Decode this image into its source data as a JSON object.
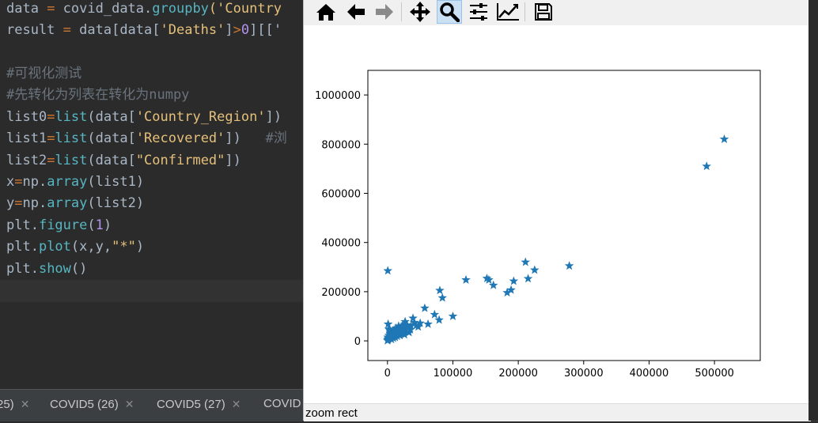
{
  "editor": {
    "lines": [
      {
        "parts": [
          [
            "data",
            "kw-var"
          ],
          [
            " = ",
            "kw-op"
          ],
          [
            "covid_data.",
            "kw-var"
          ],
          [
            "groupby",
            "kw-fn"
          ],
          [
            "('Country",
            "kw-str"
          ]
        ]
      },
      {
        "parts": [
          [
            "result",
            "kw-var"
          ],
          [
            " = ",
            "kw-op"
          ],
          [
            "data[data[",
            "kw-var"
          ],
          [
            "'Deaths'",
            "kw-str"
          ],
          [
            "]",
            "kw-var"
          ],
          [
            ">",
            "kw-op"
          ],
          [
            "0",
            "kw-num"
          ],
          [
            "][['",
            "kw-var"
          ]
        ]
      },
      {
        "parts": [
          [
            "",
            "kw-var"
          ]
        ]
      },
      {
        "parts": [
          [
            "#可视化测试",
            "kw-cmt"
          ]
        ]
      },
      {
        "parts": [
          [
            "#先转化为列表在转化为numpy",
            "kw-cmt"
          ]
        ]
      },
      {
        "parts": [
          [
            "list0",
            "kw-var"
          ],
          [
            "=",
            "kw-op"
          ],
          [
            "list",
            "kw-fn"
          ],
          [
            "(data[",
            "kw-var"
          ],
          [
            "'Country_Region'",
            "kw-str"
          ],
          [
            "])",
            "kw-var"
          ]
        ]
      },
      {
        "parts": [
          [
            "list1",
            "kw-var"
          ],
          [
            "=",
            "kw-op"
          ],
          [
            "list",
            "kw-fn"
          ],
          [
            "(data[",
            "kw-var"
          ],
          [
            "'Recovered'",
            "kw-str"
          ],
          [
            "])   ",
            "kw-var"
          ],
          [
            "#浏",
            "kw-cmt"
          ]
        ]
      },
      {
        "parts": [
          [
            "list2",
            "kw-var"
          ],
          [
            "=",
            "kw-op"
          ],
          [
            "list",
            "kw-fn"
          ],
          [
            "(data[",
            "kw-var"
          ],
          [
            "\"Confirmed\"",
            "kw-str"
          ],
          [
            "])",
            "kw-var"
          ]
        ]
      },
      {
        "parts": [
          [
            "x",
            "kw-var"
          ],
          [
            "=",
            "kw-op"
          ],
          [
            "np.",
            "kw-var"
          ],
          [
            "array",
            "kw-fn"
          ],
          [
            "(list1)",
            "kw-var"
          ]
        ]
      },
      {
        "parts": [
          [
            "y",
            "kw-var"
          ],
          [
            "=",
            "kw-op"
          ],
          [
            "np.",
            "kw-var"
          ],
          [
            "array",
            "kw-fn"
          ],
          [
            "(list2)",
            "kw-var"
          ]
        ]
      },
      {
        "parts": [
          [
            "plt.",
            "kw-var"
          ],
          [
            "figure",
            "kw-fn"
          ],
          [
            "(",
            "kw-var"
          ],
          [
            "1",
            "kw-num"
          ],
          [
            ")",
            "kw-var"
          ]
        ]
      },
      {
        "parts": [
          [
            "plt.",
            "kw-var"
          ],
          [
            "plot",
            "kw-fn"
          ],
          [
            "(x,y,",
            "kw-var"
          ],
          [
            "\"*\"",
            "kw-str"
          ],
          [
            ")",
            "kw-var"
          ]
        ]
      },
      {
        "parts": [
          [
            "plt.",
            "kw-var"
          ],
          [
            "show",
            "kw-fn"
          ],
          [
            "()",
            "kw-var"
          ]
        ]
      }
    ]
  },
  "tabs": [
    {
      "label": "25)",
      "left": -4
    },
    {
      "label": "COVID5 (26)",
      "left": 63
    },
    {
      "label": "COVID5 (27)",
      "left": 198
    },
    {
      "label": "COVID",
      "left": 333
    }
  ],
  "toolbar": {
    "icons": [
      "home-icon",
      "back-arrow-icon",
      "forward-arrow-icon",
      "pan-icon",
      "zoom-icon",
      "configure-subplots-icon",
      "edit-axis-icon",
      "save-icon"
    ],
    "active": "zoom-icon"
  },
  "status": {
    "text": "zoom rect"
  },
  "colors": {
    "marker": "#1f77b4"
  },
  "chart_data": {
    "type": "scatter",
    "marker": "*",
    "xlim": [
      -30000,
      570000
    ],
    "ylim": [
      -80000,
      1100000
    ],
    "xticks": [
      0,
      100000,
      200000,
      300000,
      400000,
      500000
    ],
    "yticks": [
      0,
      200000,
      400000,
      600000,
      800000,
      1000000
    ],
    "xtick_labels": [
      "0",
      "100000",
      "200000",
      "300000",
      "400000",
      "500000"
    ],
    "ytick_labels": [
      "0",
      "200000",
      "400000",
      "600000",
      "800000",
      "1000000"
    ],
    "x": [
      515000,
      488000,
      278000,
      225000,
      211000,
      215000,
      193000,
      189000,
      183000,
      162000,
      155000,
      152000,
      120000,
      100000,
      84000,
      80000,
      79000,
      72000,
      57000,
      62000,
      39000,
      41000,
      35000,
      30000,
      27000,
      24000,
      21000,
      18000,
      16000,
      13000,
      11000,
      9000,
      7000,
      5000,
      3000,
      2000,
      1000,
      500,
      200,
      100,
      1000,
      2000,
      4000,
      6000,
      8000,
      10000,
      12000,
      14000,
      17000,
      19000,
      22000,
      25000,
      28000,
      31000,
      33000,
      36000,
      44000,
      47000,
      50000,
      26000,
      23000,
      15000,
      9000,
      4000,
      1000,
      3000,
      500,
      2000,
      6000,
      12000
    ],
    "y": [
      820000,
      710000,
      305000,
      288000,
      320000,
      253000,
      243000,
      207000,
      196000,
      226000,
      248000,
      254000,
      248000,
      100000,
      175000,
      205000,
      85000,
      107000,
      133000,
      68000,
      92000,
      75000,
      45000,
      65000,
      78000,
      35000,
      58000,
      42000,
      28000,
      52000,
      25000,
      38000,
      20000,
      30000,
      12000,
      22000,
      8000,
      285000,
      3000,
      1000,
      68000,
      48000,
      40000,
      16000,
      33000,
      44000,
      14000,
      36000,
      60000,
      22000,
      50000,
      30000,
      47000,
      55000,
      34000,
      61000,
      62000,
      57000,
      72000,
      25000,
      62000,
      19000,
      11000,
      27000,
      5000,
      45000,
      15000,
      9000,
      6000,
      26000
    ]
  }
}
